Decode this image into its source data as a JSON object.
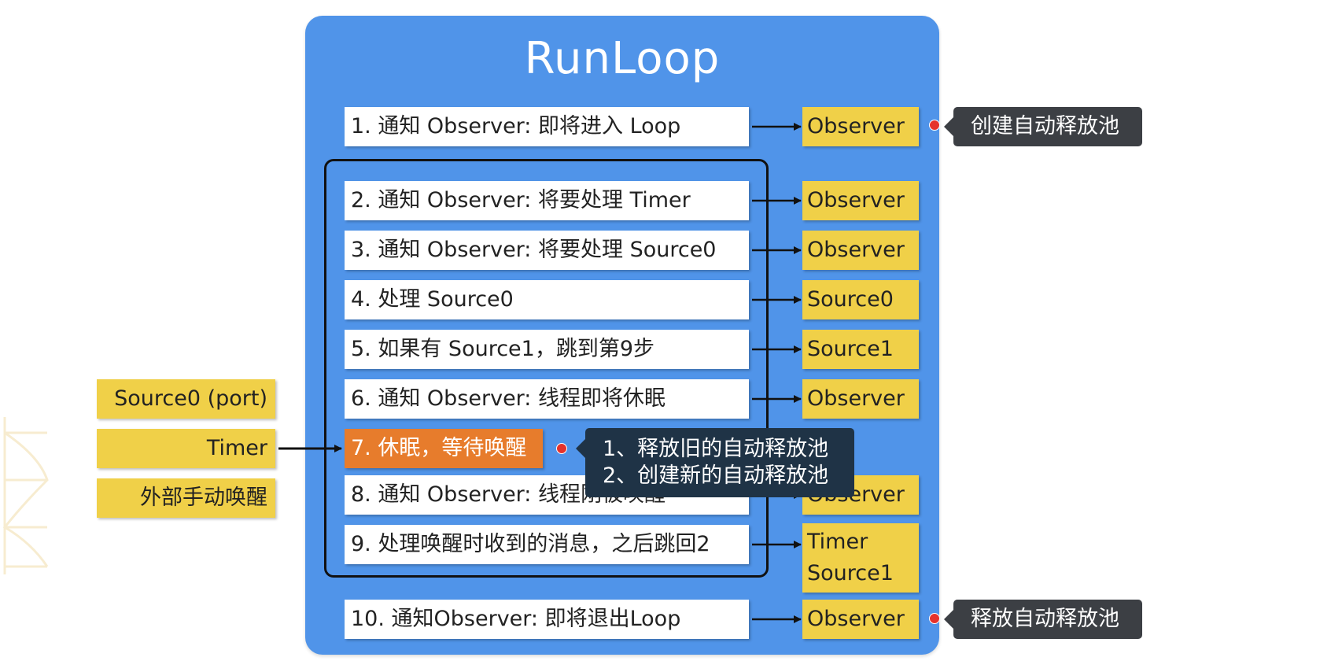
{
  "title": "RunLoop",
  "steps": [
    "1. 通知 Observer: 即将进入 Loop",
    "2. 通知 Observer: 将要处理 Timer",
    "3. 通知 Observer: 将要处理 Source0",
    "4. 处理 Source0",
    "5. 如果有 Source1，跳到第9步",
    "6. 通知 Observer: 线程即将休眠",
    "7. 休眠，等待唤醒",
    "8. 通知 Observer: 线程刚被唤醒",
    "9. 处理唤醒时收到的消息，之后跳回2",
    "10. 通知Observer: 即将退出Loop"
  ],
  "targets": [
    "Observer",
    "Observer",
    "Observer",
    "Source0",
    "Source1",
    "Observer",
    "Observer",
    "Timer",
    "Source1",
    "Observer"
  ],
  "inputs": [
    "Source0 (port)",
    "Timer",
    "外部手动唤醒"
  ],
  "callouts": {
    "enter": "创建自动释放池",
    "sleep_line1": "1、释放旧的自动释放池",
    "sleep_line2": "2、创建新的自动释放池",
    "exit": "释放自动释放池"
  },
  "colors": {
    "container": "#5094e9",
    "step": "#ffffff",
    "sleep_step": "#e77c2c",
    "target": "#f0d048",
    "callout": "#3c3f44",
    "dot": "#e5322c"
  }
}
